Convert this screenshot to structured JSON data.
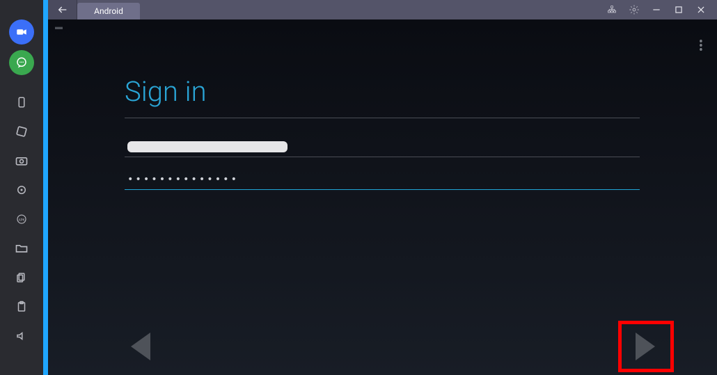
{
  "sidebar": {
    "icons": [
      {
        "name": "camcorder-icon"
      },
      {
        "name": "chat-icon"
      },
      {
        "name": "phone-icon"
      },
      {
        "name": "rotate-icon"
      },
      {
        "name": "camera-icon"
      },
      {
        "name": "location-icon"
      },
      {
        "name": "apk-icon"
      },
      {
        "name": "folder-icon"
      },
      {
        "name": "copy-icon"
      },
      {
        "name": "paste-icon"
      },
      {
        "name": "volume-icon"
      }
    ]
  },
  "titlebar": {
    "tab_label": "Android",
    "controls": {
      "network_icon": "network-icon",
      "settings_icon": "gear-icon",
      "minimize": "—",
      "maximize": "▢",
      "close": "✕"
    }
  },
  "content": {
    "signin_title": "Sign in",
    "email_value_redacted": true,
    "password_value": "••••••••••••••",
    "overflow": "⋮"
  },
  "nav": {
    "prev": "prev-arrow",
    "next": "next-arrow"
  },
  "highlight": {
    "target": "nav-next",
    "color": "#ff0000"
  }
}
